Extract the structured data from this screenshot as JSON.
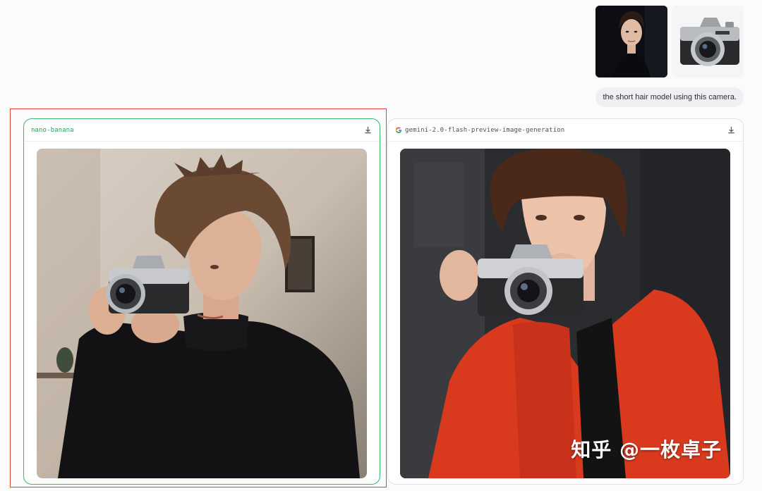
{
  "uploads": [
    {
      "description_icon": "portrait-photo"
    },
    {
      "description_icon": "camera-photo"
    }
  ],
  "user_message": "the short hair model using this camera.",
  "cards": [
    {
      "model": "nano-banana",
      "selected": true
    },
    {
      "model": "gemini-2.0-flash-preview-image-generation",
      "selected": false
    }
  ],
  "watermark": "知乎 @一枚卓子",
  "colors": {
    "highlight": "#e0453c",
    "winner_border": "#3fb36b",
    "winner_text": "#2f9e5d"
  }
}
